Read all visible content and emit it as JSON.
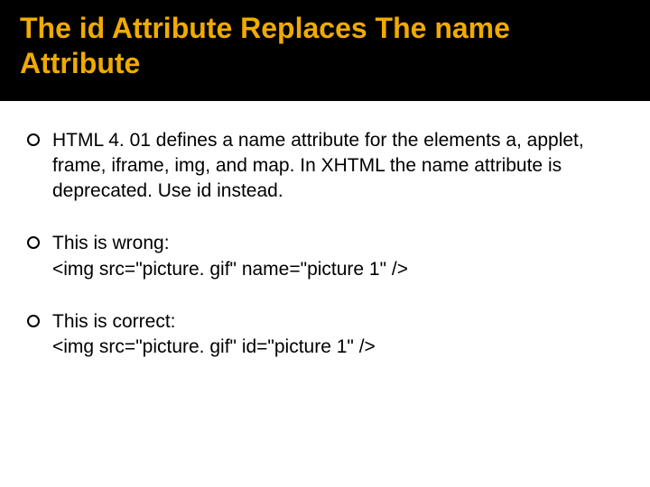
{
  "title": "The id Attribute Replaces The name Attribute",
  "bullets": [
    {
      "text": "HTML 4. 01 defines a name attribute for the elements a, applet, frame, iframe, img, and map.  In XHTML the name attribute is deprecated.  Use id instead."
    },
    {
      "text": "This is wrong:",
      "code": "<img src=\"picture. gif\" name=\"picture 1\" />"
    },
    {
      "text": "This is correct:",
      "code": "<img src=\"picture. gif\" id=\"picture 1\" />"
    }
  ]
}
